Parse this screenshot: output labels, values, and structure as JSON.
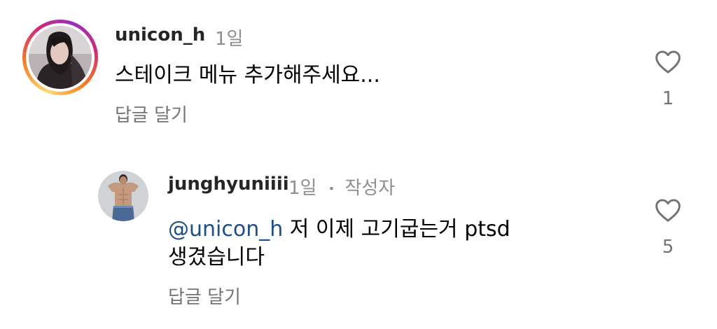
{
  "comments": [
    {
      "username": "unicon_h",
      "time": "1일",
      "text": "스테이크 메뉴 추가해주세요...",
      "reply_label": "답글 달기",
      "like_count": "1",
      "avatar": "profile-photo",
      "story_ring": true
    },
    {
      "username": "junghyuniiii",
      "time": "1일",
      "dot": "•",
      "author_badge": "작성자",
      "mention": "@unicon_h",
      "text_line1": " 저 이제 고기굽는거 ptsd",
      "text_line2": "생겼습니다",
      "reply_label": "답글 달기",
      "like_count": "5",
      "avatar": "profile-photo"
    }
  ],
  "icons": {
    "like": "heart-outline-icon"
  },
  "colors": {
    "mention": "#1d4e89",
    "meta": "#8e8e8e",
    "story_ring": [
      "#feda75",
      "#fa7e1e",
      "#d62976",
      "#962fbf"
    ]
  }
}
